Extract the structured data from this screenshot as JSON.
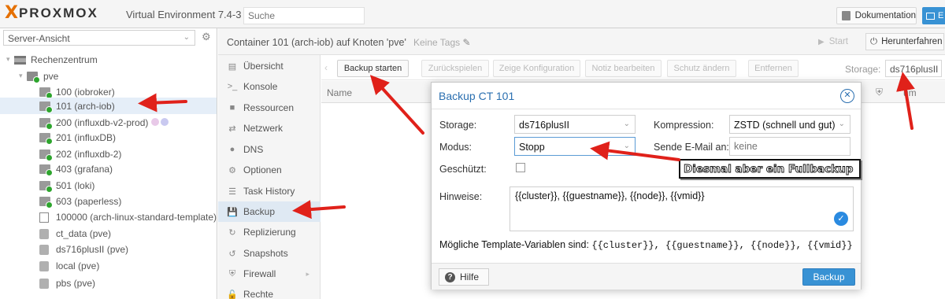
{
  "topbar": {
    "logo_x": "X",
    "logo_text": "PROXMOX",
    "title": "Virtual Environment 7.4-3",
    "search_placeholder": "Suche",
    "doku_label": "Dokumentation",
    "create_label": "E"
  },
  "tree": {
    "view_label": "Server-Ansicht",
    "items": [
      {
        "label": "Rechenzentrum",
        "icon": "datacenter-icon"
      },
      {
        "label": "pve",
        "icon": "node-icon"
      },
      {
        "label": "100 (iobroker)",
        "icon": "container-icon"
      },
      {
        "label": "101 (arch-iob)",
        "icon": "container-icon"
      },
      {
        "label": "200 (influxdb-v2-prod)",
        "icon": "container-icon"
      },
      {
        "label": "201 (influxDB)",
        "icon": "container-icon"
      },
      {
        "label": "202 (influxdb-2)",
        "icon": "container-icon"
      },
      {
        "label": "403 (grafana)",
        "icon": "container-icon"
      },
      {
        "label": "501 (loki)",
        "icon": "container-icon"
      },
      {
        "label": "603 (paperless)",
        "icon": "container-icon"
      },
      {
        "label": "100000 (arch-linux-standard-template)",
        "icon": "template-icon"
      },
      {
        "label": "ct_data (pve)",
        "icon": "storage-icon"
      },
      {
        "label": "ds716plusII (pve)",
        "icon": "storage-icon"
      },
      {
        "label": "local (pve)",
        "icon": "storage-icon"
      },
      {
        "label": "pbs (pve)",
        "icon": "storage-icon"
      }
    ],
    "tag_colors": [
      "#e8c9e8",
      "#c9c9f0"
    ]
  },
  "header": {
    "title": "Container 101 (arch-iob) auf Knoten 'pve'",
    "no_tags": "Keine Tags",
    "start_label": "Start",
    "shutdown_label": "Herunterfahren"
  },
  "subnav": {
    "items": [
      {
        "label": "Übersicht",
        "icon": "summary-icon"
      },
      {
        "label": "Konsole",
        "icon": "console-icon"
      },
      {
        "label": "Ressourcen",
        "icon": "resources-icon"
      },
      {
        "label": "Netzwerk",
        "icon": "network-icon"
      },
      {
        "label": "DNS",
        "icon": "dns-icon"
      },
      {
        "label": "Optionen",
        "icon": "options-icon"
      },
      {
        "label": "Task History",
        "icon": "task-history-icon"
      },
      {
        "label": "Backup",
        "icon": "backup-icon"
      },
      {
        "label": "Replizierung",
        "icon": "replication-icon"
      },
      {
        "label": "Snapshots",
        "icon": "snapshots-icon"
      },
      {
        "label": "Firewall",
        "icon": "firewall-icon"
      },
      {
        "label": "Rechte",
        "icon": "permissions-icon"
      }
    ]
  },
  "toolbar": {
    "backup_now": "Backup starten",
    "restore": "Zurückspielen",
    "show_config": "Zeige Konfiguration",
    "edit_notes": "Notiz bearbeiten",
    "change_protection": "Schutz ändern",
    "remove": "Entfernen",
    "storage_label": "Storage:",
    "storage_value": "ds716plusII"
  },
  "grid": {
    "col_name": "Name",
    "col_right": "um"
  },
  "modal": {
    "title": "Backup CT 101",
    "storage_label": "Storage:",
    "storage_value": "ds716plusII",
    "compression_label": "Kompression:",
    "compression_value": "ZSTD (schnell und gut)",
    "mode_label": "Modus:",
    "mode_value": "Stopp",
    "email_label": "Sende E-Mail an:",
    "email_placeholder": "keine",
    "protected_label": "Geschützt:",
    "notes_label": "Hinweise:",
    "notes_value": "{{cluster}}, {{guestname}}, {{node}}, {{vmid}}",
    "template_vars_label": "Mögliche Template-Variablen sind:",
    "template_vars": "{{cluster}}, {{guestname}}, {{node}}, {{vmid}}",
    "help_label": "Hilfe",
    "backup_label": "Backup"
  },
  "annotation": {
    "text": "Diesmal aber ein Fullbackup",
    "arrow_color": "#e0211a"
  },
  "colors": {
    "accent": "#3892d4",
    "logo_orange": "#e57000",
    "running_green": "#2ea52e"
  }
}
